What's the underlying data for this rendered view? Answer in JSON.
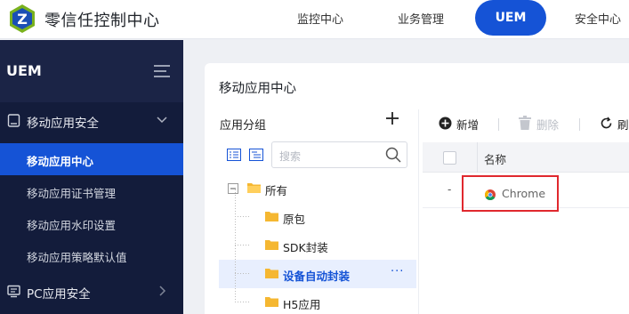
{
  "header": {
    "app_title": "零信任控制中心",
    "nav": [
      "监控中心",
      "业务管理",
      "UEM",
      "安全中心"
    ],
    "active_nav": "UEM"
  },
  "sidebar": {
    "title": "UEM",
    "groups": [
      {
        "label": "移动应用安全",
        "expanded": true,
        "items": [
          "移动应用中心",
          "移动应用证书管理",
          "移动应用水印设置",
          "移动应用策略默认值"
        ],
        "active_item": "移动应用中心"
      },
      {
        "label": "PC应用安全",
        "expanded": false
      }
    ]
  },
  "main": {
    "title": "移动应用中心",
    "group_panel": {
      "title": "应用分组",
      "search_placeholder": "搜索",
      "tree": [
        {
          "label": "所有",
          "level": 0,
          "expand_icon": "minus"
        },
        {
          "label": "原包",
          "level": 1
        },
        {
          "label": "SDK封装",
          "level": 1
        },
        {
          "label": "设备自动封装",
          "level": 1,
          "selected": true,
          "more": "···"
        },
        {
          "label": "H5应用",
          "level": 1
        }
      ]
    },
    "toolbar": {
      "add": "新增",
      "delete": "删除",
      "refresh": "刷"
    },
    "table": {
      "columns": [
        "名称"
      ],
      "rows": [
        {
          "index": "-",
          "name": "Chrome",
          "icon": "chrome-icon"
        }
      ]
    }
  },
  "colors": {
    "primary": "#1553d6",
    "sidebar": "#131c3b",
    "highlight": "#e0282e",
    "folder": "#f5b731"
  }
}
